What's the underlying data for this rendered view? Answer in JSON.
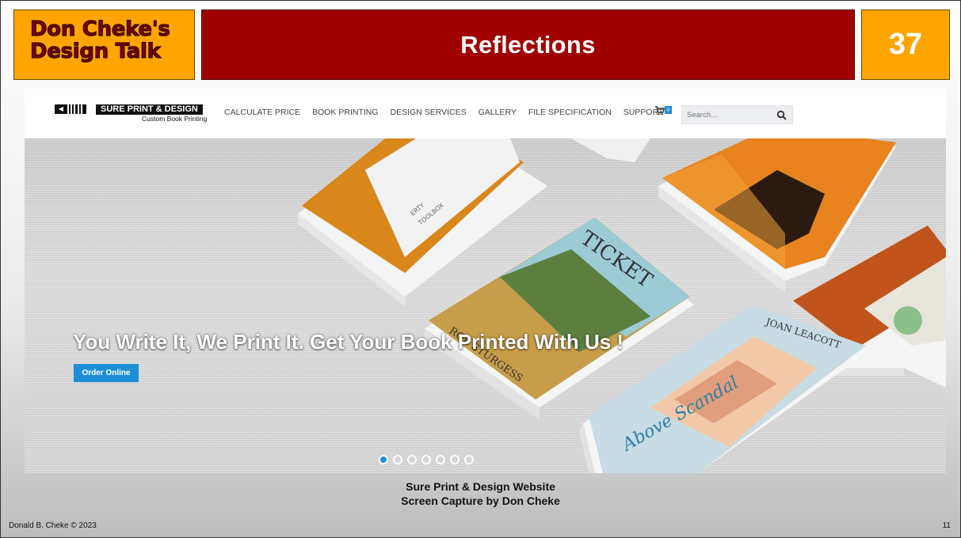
{
  "slide": {
    "brand_line1": "Don Cheke's",
    "brand_line2": "Design Talk",
    "title": "Reflections",
    "number": "37"
  },
  "site": {
    "logo": {
      "name": "SURE PRINT & DESIGN",
      "tagline": "Custom Book Printing"
    },
    "menu": [
      "CALCULATE PRICE",
      "BOOK PRINTING",
      "DESIGN SERVICES",
      "GALLERY",
      "FILE SPECIFICATION",
      "SUPPORT"
    ],
    "cart_count": "0",
    "search_placeholder": "Search...",
    "hero": {
      "headline": "You Write It, We Print It. Get Your Book Printed With Us !",
      "cta": "Order Online",
      "slides_total": 7,
      "slide_active": 1,
      "book_titles": {
        "ticket": "TICKET",
        "rob": "ROB STURGESS",
        "joan": "JOAN LEACOTT",
        "above": "Above Scandal",
        "toolbox": "TOOLBOX",
        "erty": "ERTY"
      }
    }
  },
  "caption": {
    "line1": "Sure Print & Design Website",
    "line2": "Screen Capture by Don Cheke"
  },
  "footer": {
    "copyright": "Donald B. Cheke © 2023",
    "page": "11"
  },
  "colors": {
    "brand_orange": "#ffa400",
    "title_red": "#a00000",
    "site_blue": "#1d8fd6"
  }
}
